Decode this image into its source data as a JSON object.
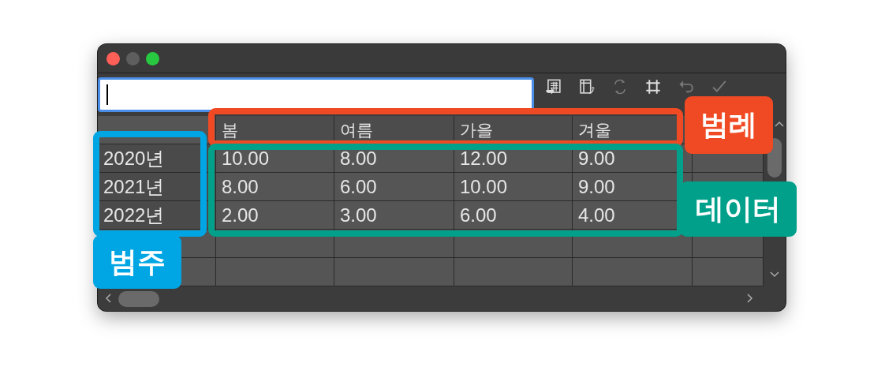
{
  "table": {
    "columns": [
      "봄",
      "여름",
      "가을",
      "겨울"
    ],
    "rows": [
      {
        "category": "2020년",
        "values": [
          "10.00",
          "8.00",
          "12.00",
          "9.00"
        ]
      },
      {
        "category": "2021년",
        "values": [
          "8.00",
          "6.00",
          "10.00",
          "9.00"
        ]
      },
      {
        "category": "2022년",
        "values": [
          "2.00",
          "3.00",
          "6.00",
          "4.00"
        ]
      }
    ]
  },
  "annotations": [
    {
      "kind": "legend",
      "label": "범례",
      "color": "#f04a24"
    },
    {
      "kind": "data",
      "label": "데이터",
      "color": "#00a08a"
    },
    {
      "kind": "category",
      "label": "범주",
      "color": "#00a6e4"
    }
  ]
}
